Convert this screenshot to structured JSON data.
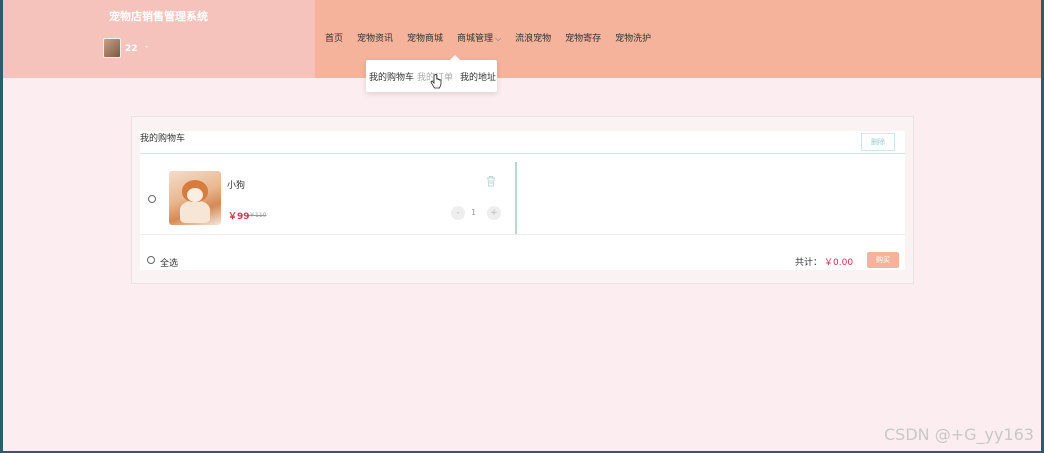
{
  "header": {
    "site_title": "宠物店销售管理系统",
    "user_name": "22",
    "user_caret": "-"
  },
  "nav": {
    "items": [
      "首页",
      "宠物资讯",
      "宠物商城",
      "商城管理",
      "流浪宠物",
      "宠物寄存",
      "宠物洗护"
    ]
  },
  "dropdown": {
    "items": [
      "我的购物车",
      "我的订单",
      "我的地址"
    ]
  },
  "cart": {
    "title": "我的购物车",
    "delete_label": "删除",
    "item": {
      "name": "小狗",
      "price": "￥99",
      "original_price": "￥110",
      "quantity": "1"
    },
    "select_all_label": "全选",
    "total_label": "共计：",
    "total_value": "￥0.00",
    "buy_label": "购买"
  },
  "watermark": "CSDN @+G_yy163",
  "colors": {
    "header_bg": "#f5b39b",
    "brand_bg": "#f6c3bc",
    "page_bg": "#fcedf0",
    "price_red": "#d0344a"
  }
}
